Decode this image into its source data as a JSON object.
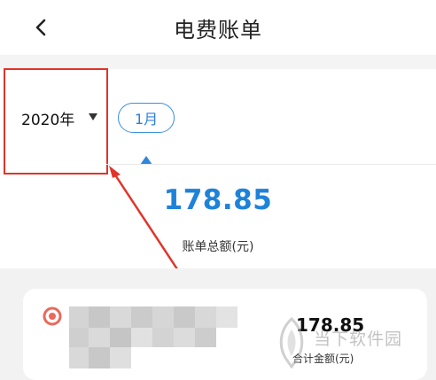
{
  "header": {
    "title": "电费账单",
    "back_icon": "chevron-left-icon"
  },
  "filter": {
    "year": "2020年",
    "caret_icon": "triangle-down-icon",
    "months": [
      "1月"
    ],
    "selected_month": "1月"
  },
  "summary": {
    "total_amount": "178.85",
    "total_label": "账单总额(元)"
  },
  "bill": {
    "amount": "178.85",
    "label": "合计金额(元)",
    "icon": "record-icon"
  },
  "watermark": {
    "text": "当下软件园"
  },
  "colors": {
    "accent": "#1e82d8",
    "highlight_box": "#e0342a",
    "arrow": "#e0342a"
  }
}
